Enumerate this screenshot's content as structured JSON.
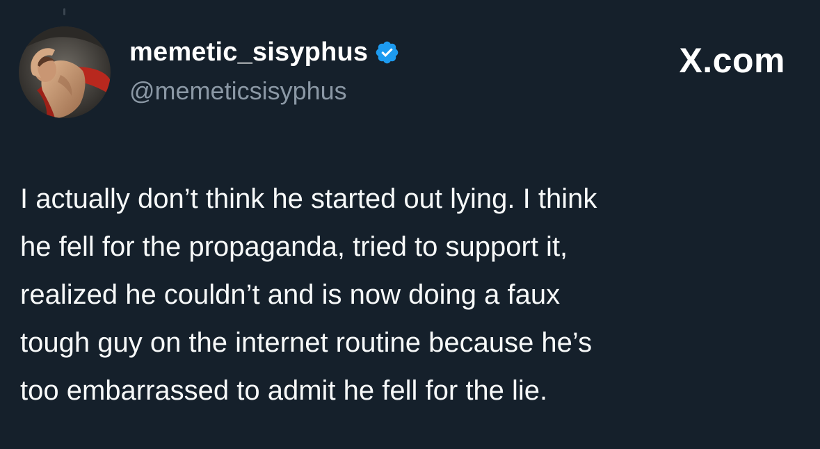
{
  "author": {
    "display_name": "memetic_sisyphus",
    "handle": "@memeticsisyphus",
    "verified": true,
    "avatar_icon": "sisyphus-painting-avatar"
  },
  "brand": {
    "label": "X.com"
  },
  "tweet": {
    "lines": [
      "I actually don’t think he started out lying. I think",
      "he fell for the propaganda, tried to support it,",
      "realized he couldn’t and is now doing a faux",
      "tough guy on the internet routine because he’s",
      "too embarrassed to admit he fell for the lie."
    ]
  },
  "colors": {
    "background": "#15202b",
    "verified_badge": "#1d9bf0",
    "secondary_text": "#8b98a5",
    "primary_text": "#f7f9f9"
  }
}
